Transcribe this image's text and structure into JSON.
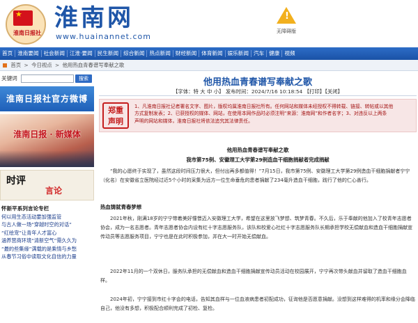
{
  "header": {
    "logo_paper": "淮南日报社",
    "site_title": "淮南网",
    "site_url": "www.huainannet.com",
    "notice_text": "无障碍版"
  },
  "nav": [
    "首页",
    "淮南要闻",
    "社会新闻",
    "江淮·要闻",
    "民生新闻",
    "综合新闻",
    "热点新闻",
    "财经新闻",
    "体育新闻",
    "娱乐新闻",
    "汽车",
    "健康",
    "视频"
  ],
  "breadcrumb": {
    "items": [
      "首页",
      "今日视点",
      "他用热血青春谱写奉献之歌"
    ],
    "sep": ">"
  },
  "sidebar": {
    "kw_label": "关键词",
    "kw_btn": "搜索",
    "weibo": "淮南日报社官方微博",
    "banner2": "淮南日报 · 新媒体",
    "banner3_a": "时评",
    "banner3_b": "言论",
    "col_title": "怀新平系列言论专栏",
    "col_items": [
      "何以用生态活动要加强监管",
      "与古人做一场“穿越时空的对话”",
      "“红绘宠”让青年人才富心",
      "涵养营商环境“清新空气”需久久为",
      "“最的些集缘”满载的是乘情与乡愁",
      "从春节习俗中读取文化自信的力量"
    ]
  },
  "article": {
    "title": "他用热血青春谱写奉献之歌",
    "meta": "【字体：特 大 中 小】 发布时间：2024/7/16 10:18:54 【打印】【关闭】",
    "decl_badge_a": "郑重",
    "decl_badge_b": "声明",
    "decl_lines": [
      "1、凡淮南日报社记者署名文字、图片，版权均属淮南日报社所有。任何网站和媒体未经授权不得转载、链接、转帖或以其他",
      "方式复制发表；2、已获授权的媒体、网站，在使用本网作品时必须注明“来源：淮南网”和作者名字；3、对违反以上两条",
      "声明的网站和媒体，淮南日报社将依法追究其法律责任。"
    ],
    "sub1": "他用热血青春谱写奉献之歌",
    "sub2": "我市第75例、安徽理工大学第29例造血干细胞捐献者完成捐献",
    "para1": "“我的心愿终于实现了，虽然这段时间压力很大，但付出再多都值得！”7月15日，我市第75例、安徽理工大学第29例造血干细胞捐献者宁宁（化名）在安徽省立医院经过近5个小时的采集为远方一位生命垂危的患者捐献了234毫升造血干细胞，践行了他的仁心善行。",
    "sec1": "热血铸就青春梦想",
    "para2": "2021年秋，刚满18岁的宁宁带着美好憧憬迈入安徽理工大学，希望在这里放飞梦想、筑梦青春。不久后，乐于奉献的他加入了校青年志愿者协会，成为一名志愿者。青年志愿者协会内设有红十字志愿服务队，该队和校爱心社红十字志愿服务队长期承担学校无偿献血和造血干细胞捐献宣传动员等志愿服务项目，宁宁也是在此时积极参加，并在大一时开始无偿献血。",
    "para3": "2022年11月的一个双休日，服务队承担的无偿献血和造血干细胞捐献宣传动员活动在校园展开，宁宁再次带头献血并留取了造血干细胞血样。",
    "para4": "2024年初，宁宁接到市红十字会的电话，告知其血样与一位血液病患者初配成功，征询他是否愿意捐献。没想到这样难得的机率和缘分会降临自己，他没有多想，积极配合顺利完成了初检、复检。"
  }
}
